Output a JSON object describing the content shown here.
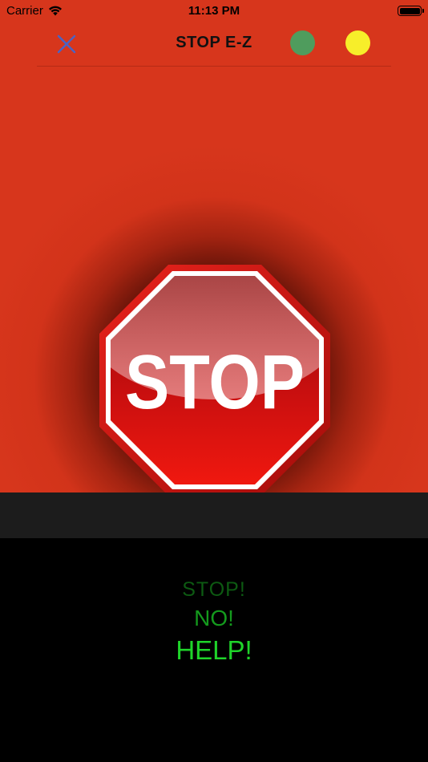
{
  "status_bar": {
    "carrier": "Carrier",
    "time": "11:13 PM"
  },
  "nav": {
    "title": "STOP E-Z",
    "close_icon": "close-icon",
    "green_dot_color": "#4f9c5d",
    "yellow_dot_color": "#f7ee2a"
  },
  "main": {
    "stop_sign_label": "STOP",
    "background_color": "#d7361c"
  },
  "phrases": [
    {
      "text": "STOP!"
    },
    {
      "text": "NO!"
    },
    {
      "text": "HELP!"
    }
  ]
}
